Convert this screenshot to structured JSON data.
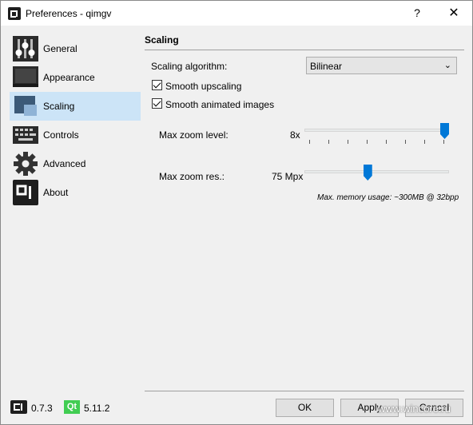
{
  "window": {
    "title": "Preferences - qimgv",
    "help_glyph": "?",
    "close_glyph": "✕"
  },
  "sidebar": {
    "items": [
      {
        "label": "General",
        "icon": "sliders-icon",
        "selected": false
      },
      {
        "label": "Appearance",
        "icon": "monitor-icon",
        "selected": false
      },
      {
        "label": "Scaling",
        "icon": "scaling-icon",
        "selected": true
      },
      {
        "label": "Controls",
        "icon": "keyboard-icon",
        "selected": false
      },
      {
        "label": "Advanced",
        "icon": "gear-icon",
        "selected": false
      },
      {
        "label": "About",
        "icon": "qimgv-logo-icon",
        "selected": false
      }
    ]
  },
  "scaling": {
    "section_title": "Scaling",
    "algorithm_label": "Scaling algorithm:",
    "algorithm_value": "Bilinear",
    "smooth_upscaling_label": "Smooth upscaling",
    "smooth_upscaling_checked": true,
    "smooth_animated_label": "Smooth animated images",
    "smooth_animated_checked": true,
    "max_zoom_label": "Max zoom level:",
    "max_zoom_value": "8x",
    "max_zoom_level_fraction": 1.0,
    "max_zoom_res_label": "Max zoom res.:",
    "max_zoom_res_value": "75 Mpx",
    "max_zoom_res_fraction": 0.45,
    "memory_note": "Max. memory usage: ~300MB @ 32bpp"
  },
  "buttons": {
    "ok": "OK",
    "apply": "Apply",
    "cancel": "Cancel"
  },
  "footer": {
    "app_version": "0.7.3",
    "qt_badge": "Qt",
    "qt_version": "5.11.2"
  },
  "watermark": "www.wincore.ru",
  "colors": {
    "accent": "#0078d7",
    "selection": "#cce4f7",
    "qt_green": "#41cd52"
  }
}
